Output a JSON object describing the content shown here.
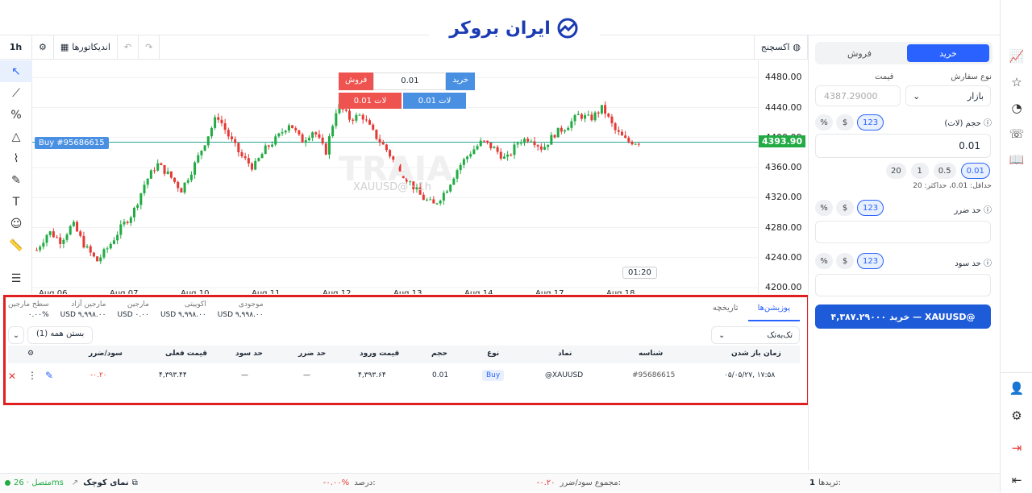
{
  "logo": {
    "text": "ایران بروکر"
  },
  "chart_toolbar": {
    "timeframe": "1h",
    "indicators_label": "اندیکاتورها",
    "exchange_label": "اکسچنج"
  },
  "trade_widget": {
    "buy_label": "خرید",
    "sell_label": "فروش",
    "qty": "0.01",
    "lot_buy": "لات 0.01",
    "lot_sell": "لات 0.01"
  },
  "chart": {
    "position_label": "Buy #95686615",
    "watermark": "TRAIA",
    "symbol_tf": "XAUUSD@ · 1h",
    "countdown": "01:20",
    "current_price": "4393.90",
    "price_labels": [
      "4480.00",
      "4440.00",
      "4400.00",
      "4360.00",
      "4320.00",
      "4280.00",
      "4240.00",
      "4200.00"
    ],
    "x_labels": [
      "Aug 06",
      "Aug 07",
      "Aug 10",
      "Aug 11",
      "Aug 12",
      "Aug 13",
      "Aug 14",
      "Aug 17",
      "Aug 18"
    ]
  },
  "chart_data": {
    "type": "candlestick",
    "ylim": [
      4200,
      4490
    ],
    "current_price": 4393.9,
    "x": [
      "Aug 06",
      "Aug 07",
      "Aug 10",
      "Aug 11",
      "Aug 12",
      "Aug 13",
      "Aug 14",
      "Aug 17",
      "Aug 18"
    ],
    "close_path": [
      4250,
      4275,
      4262,
      4285,
      4255,
      4235,
      4255,
      4280,
      4300,
      4340,
      4365,
      4350,
      4330,
      4360,
      4395,
      4430,
      4400,
      4375,
      4360,
      4385,
      4400,
      4420,
      4395,
      4410,
      4380,
      4445,
      4425,
      4430,
      4405,
      4385,
      4360,
      4340,
      4320,
      4310,
      4330,
      4360,
      4380,
      4395,
      4385,
      4370,
      4395,
      4400,
      4385,
      4405,
      4415,
      4430,
      4425,
      4440,
      4410,
      4395,
      4393.9
    ]
  },
  "positions": {
    "tabs": [
      "پوزیشن‌ها",
      "تاریخچه"
    ],
    "summary": [
      {
        "label": "موجودی",
        "value": "USD ۹,۹۹۸.۰۰"
      },
      {
        "label": "اکوییتی",
        "value": "USD ۹,۹۹۸.۰۰"
      },
      {
        "label": "مارجین",
        "value": "USD ۰.۰۰"
      },
      {
        "label": "مارجین آزاد",
        "value": "USD ۹,۹۹۸.۰۰"
      },
      {
        "label": "سطح مارجین",
        "value": "۰.۰۰%"
      }
    ],
    "filter": "تک‌به‌تک",
    "close_all": "بستن همه (1)",
    "columns": [
      "زمان باز شدن",
      "شناسه",
      "نماد",
      "نوع",
      "حجم",
      "قیمت ورود",
      "حد ضرر",
      "حد سود",
      "قیمت فعلی",
      "سود/ضرر"
    ],
    "row": {
      "time": "۰۵/۰۵/۲۷, ۱۷:۵۸",
      "id": "#95686615",
      "symbol": "@XAUUSD",
      "type": "Buy",
      "volume": "0.01",
      "entry": "۴,۳۹۳.۶۴",
      "sl": "—",
      "tp": "—",
      "current": "۴,۳۹۳.۴۴",
      "pnl": "-۰.۲۰"
    }
  },
  "order_panel": {
    "buy_tab": "خرید",
    "sell_tab": "فروش",
    "order_type_label": "نوع سفارش",
    "price_label": "قیمت",
    "order_type_value": "بازار",
    "price_placeholder": "4387.29000",
    "volume_label": "حجم (لات)",
    "volume_value": "0.01",
    "lot_chips": [
      "0.01",
      "0.5",
      "1",
      "20"
    ],
    "lot_hint": "حداقل: 0.01، حداکثر: 20",
    "sl_label": "حد ضرر",
    "tp_label": "حد سود",
    "mode_chip": "123",
    "submit": "خرید ۴,۳۸۷.۲۹۰۰۰ — XAUUSD@"
  },
  "statusbar": {
    "connection": "متصل · 26ms",
    "mini_view": "نمای کوچک",
    "percent_label": "درصد:",
    "percent_value": "-۰.۰۰%",
    "total_pnl_label": "مجموع سود/ضرر:",
    "total_pnl_value": "-۰.۲۰",
    "trades_label": "تریدها:",
    "trades_value": "1"
  },
  "colors": {
    "buy": "#2962ff",
    "sell": "#ef5350",
    "up": "#26a69a",
    "green_candle": "#22ab44",
    "red_candle": "#e53935",
    "frame": "#e02020"
  }
}
